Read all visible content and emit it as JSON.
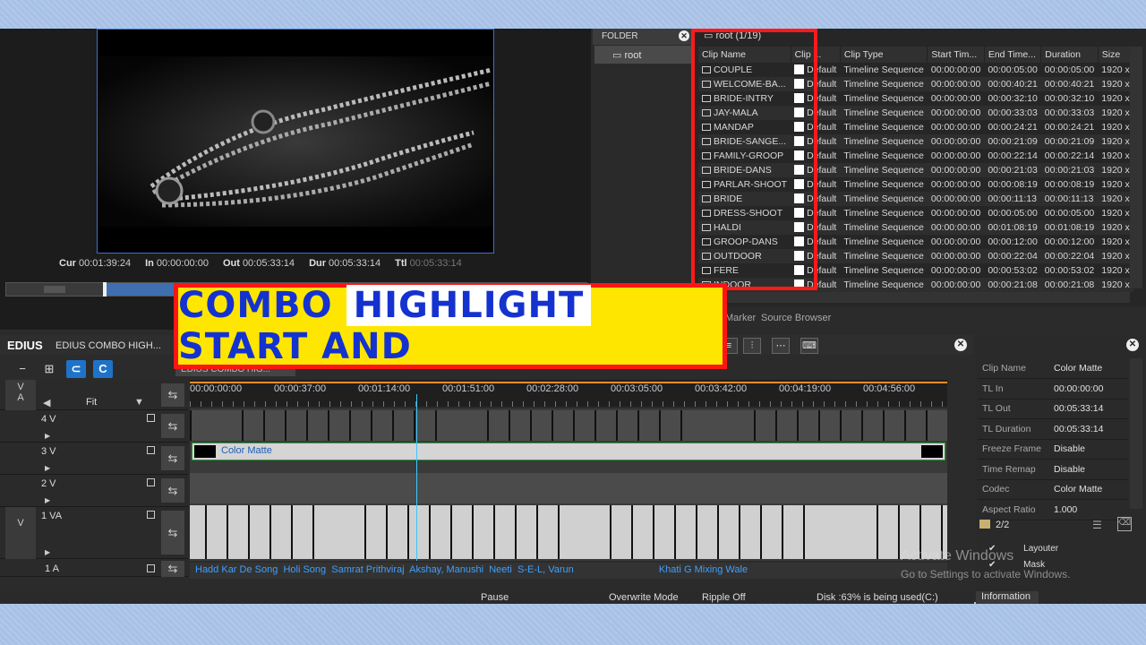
{
  "player": {
    "timecodes": [
      {
        "label": "Cur",
        "value": "00:01:39:24"
      },
      {
        "label": "In",
        "value": "00:00:00:00"
      },
      {
        "label": "Out",
        "value": "00:05:33:14"
      },
      {
        "label": "Dur",
        "value": "00:05:33:14"
      },
      {
        "label": "Ttl",
        "value": "00:05:33:14"
      }
    ]
  },
  "folder": {
    "title": "FOLDER",
    "root_label": "root"
  },
  "bin": {
    "path": "root (1/19)",
    "columns": [
      "Clip Name",
      "Clip ...",
      "Clip Type",
      "Start Tim...",
      "End Time...",
      "Duration",
      "Size"
    ],
    "rows": [
      [
        "COUPLE",
        "Default",
        "Timeline Sequence",
        "00:00:00:00",
        "00:00:05:00",
        "00:00:05:00",
        "1920 x"
      ],
      [
        "WELCOME-BA...",
        "Default",
        "Timeline Sequence",
        "00:00:00:00",
        "00:00:40:21",
        "00:00:40:21",
        "1920 x"
      ],
      [
        "BRIDE-INTRY",
        "Default",
        "Timeline Sequence",
        "00:00:00:00",
        "00:00:32:10",
        "00:00:32:10",
        "1920 x"
      ],
      [
        "JAY-MALA",
        "Default",
        "Timeline Sequence",
        "00:00:00:00",
        "00:00:33:03",
        "00:00:33:03",
        "1920 x"
      ],
      [
        "MANDAP",
        "Default",
        "Timeline Sequence",
        "00:00:00:00",
        "00:00:24:21",
        "00:00:24:21",
        "1920 x"
      ],
      [
        "BRIDE-SANGE...",
        "Default",
        "Timeline Sequence",
        "00:00:00:00",
        "00:00:21:09",
        "00:00:21:09",
        "1920 x"
      ],
      [
        "FAMILY-GROOP",
        "Default",
        "Timeline Sequence",
        "00:00:00:00",
        "00:00:22:14",
        "00:00:22:14",
        "1920 x"
      ],
      [
        "BRIDE-DANS",
        "Default",
        "Timeline Sequence",
        "00:00:00:00",
        "00:00:21:03",
        "00:00:21:03",
        "1920 x"
      ],
      [
        "PARLAR-SHOOT",
        "Default",
        "Timeline Sequence",
        "00:00:00:00",
        "00:00:08:19",
        "00:00:08:19",
        "1920 x"
      ],
      [
        "BRIDE",
        "Default",
        "Timeline Sequence",
        "00:00:00:00",
        "00:00:11:13",
        "00:00:11:13",
        "1920 x"
      ],
      [
        "DRESS-SHOOT",
        "Default",
        "Timeline Sequence",
        "00:00:00:00",
        "00:00:05:00",
        "00:00:05:00",
        "1920 x"
      ],
      [
        "HALDI",
        "Default",
        "Timeline Sequence",
        "00:00:00:00",
        "00:01:08:19",
        "00:01:08:19",
        "1920 x"
      ],
      [
        "GROOP-DANS",
        "Default",
        "Timeline Sequence",
        "00:00:00:00",
        "00:00:12:00",
        "00:00:12:00",
        "1920 x"
      ],
      [
        "OUTDOOR",
        "Default",
        "Timeline Sequence",
        "00:00:00:00",
        "00:00:22:04",
        "00:00:22:04",
        "1920 x"
      ],
      [
        "FERE",
        "Default",
        "Timeline Sequence",
        "00:00:00:00",
        "00:00:53:02",
        "00:00:53:02",
        "1920 x"
      ],
      [
        "INDOOR",
        "Default",
        "Timeline Sequence",
        "00:00:00:00",
        "00:00:21:08",
        "00:00:21:08",
        "1920 x"
      ]
    ],
    "tabs": [
      "Marker",
      "Source Browser"
    ]
  },
  "banner": {
    "word1": "COMBO",
    "word2": "HIGHLIGHT",
    "word3": "START AND"
  },
  "timeline": {
    "app_name": "EDIUS",
    "sequence_name": "EDIUS COMBO HIGH...",
    "sequence_tab": "EDIUS COMBO HIG...",
    "zoom": "Fit",
    "ruler": [
      "00:00:00:00",
      "00:00:37:00",
      "00:01:14:00",
      "00:01:51:00",
      "00:02:28:00",
      "00:03:05:00",
      "00:03:42:00",
      "00:04:19:00",
      "00:04:56:00"
    ],
    "tracks": [
      "4 V",
      "3 V",
      "2 V",
      "1 VA",
      "1 A"
    ],
    "track_va_labels": [
      "V",
      "A",
      "V"
    ],
    "matte_label": "Color Matte",
    "audio_clips": [
      "Hadd Kar De Song",
      "Holi Song",
      "Samrat Prithviraj",
      "Akshay, Manushi",
      "Neeti",
      "S-E-L, Varun",
      "Khati G Mixing Wale"
    ]
  },
  "status": {
    "pause": "Pause",
    "overwrite": "Overwrite Mode",
    "ripple": "Ripple Off",
    "disk": "Disk :63% is being used(C:)"
  },
  "info": {
    "props": [
      [
        "Clip Name",
        "Color Matte"
      ],
      [
        "TL In",
        "00:00:00:00"
      ],
      [
        "TL Out",
        "00:05:33:14"
      ],
      [
        "TL Duration",
        "00:05:33:14"
      ],
      [
        "Freeze Frame",
        "Disable"
      ],
      [
        "Time Remap",
        "Disable"
      ],
      [
        "Codec",
        "Color Matte"
      ],
      [
        "Aspect Ratio",
        "1.000"
      ]
    ],
    "layer_count": "2/2",
    "layers": [
      "Layouter",
      "Mask"
    ],
    "tab": "Information"
  },
  "watermark": {
    "title": "Activate Windows",
    "subtitle": "Go to Settings to activate Windows."
  },
  "colors": {
    "banner_bg": "#ffe600",
    "banner_border": "#ff1414",
    "banner_text": "#1432d0",
    "highlight_box": "#ff1a1a",
    "accent_blue": "#1e73c8"
  }
}
